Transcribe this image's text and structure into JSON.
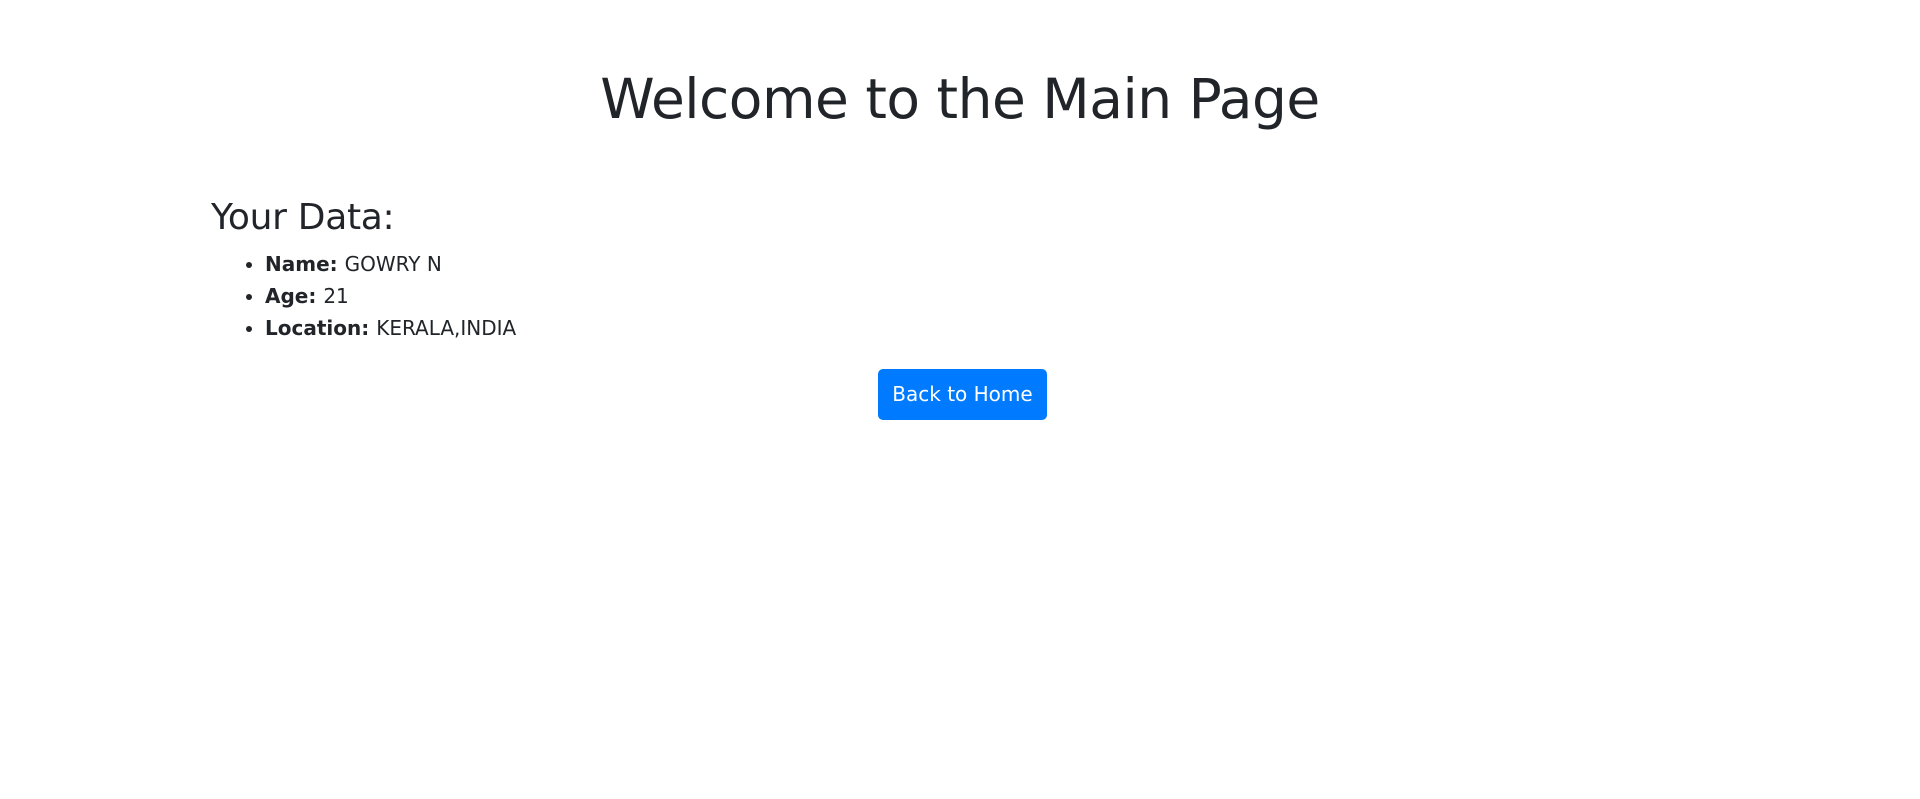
{
  "page": {
    "title": "Welcome to the Main Page"
  },
  "data_section": {
    "heading": "Your Data:",
    "items": [
      {
        "label": "Name:",
        "value": "GOWRY N"
      },
      {
        "label": "Age:",
        "value": "21"
      },
      {
        "label": "Location:",
        "value": "KERALA,INDIA"
      }
    ]
  },
  "actions": {
    "back_label": "Back to Home"
  },
  "colors": {
    "button_background": "#007bff",
    "button_text": "#ffffff",
    "text": "#212529",
    "background": "#ffffff"
  }
}
